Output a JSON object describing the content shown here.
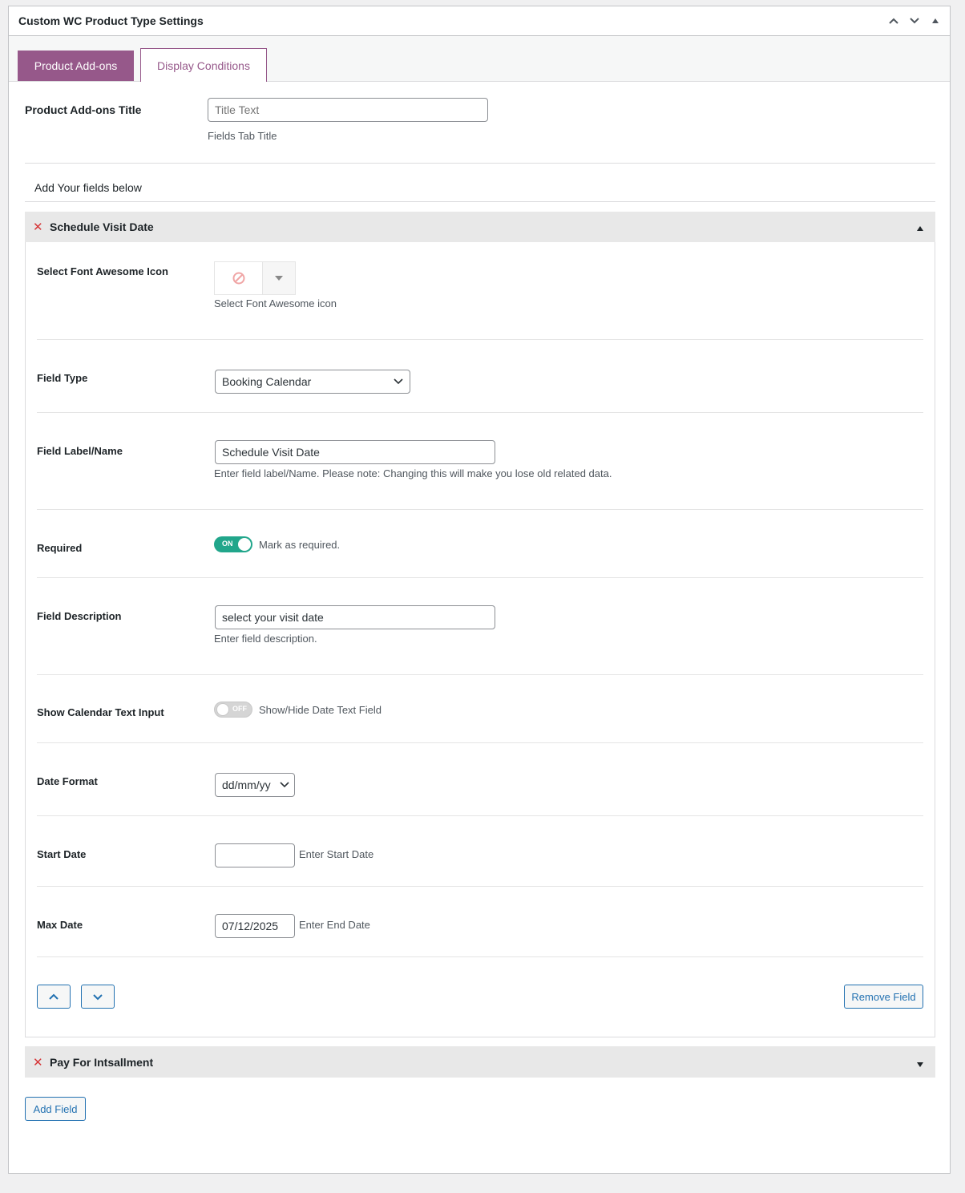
{
  "metabox": {
    "title": "Custom WC Product Type Settings"
  },
  "tabs": [
    {
      "label": "Product Add-ons",
      "active": true
    },
    {
      "label": "Display Conditions",
      "active": false
    }
  ],
  "addons_title": {
    "label": "Product Add-ons Title",
    "placeholder": "Title Text",
    "description": "Fields Tab Title"
  },
  "fields_intro": "Add Your fields below",
  "fields": [
    {
      "title": "Schedule Visit Date",
      "expanded": true,
      "icon": {
        "label": "Select Font Awesome Icon",
        "description": "Select Font Awesome icon",
        "selected_icon": "ban-icon"
      },
      "field_type": {
        "label": "Field Type",
        "value": "Booking Calendar"
      },
      "field_label": {
        "label": "Field Label/Name",
        "value": "Schedule Visit Date",
        "description": "Enter field label/Name. Please note: Changing this will make you lose old related data."
      },
      "required": {
        "label": "Required",
        "state_text": "ON",
        "on": true,
        "description": "Mark as required."
      },
      "field_description": {
        "label": "Field Description",
        "value": "select your visit date",
        "description": "Enter field description."
      },
      "show_calendar_input": {
        "label": "Show Calendar Text Input",
        "state_text": "OFF",
        "on": false,
        "description": "Show/Hide Date Text Field"
      },
      "date_format": {
        "label": "Date Format",
        "value": "dd/mm/yy"
      },
      "start_date": {
        "label": "Start Date",
        "value": "",
        "description": "Enter Start Date"
      },
      "max_date": {
        "label": "Max Date",
        "value": "07/12/2025",
        "description": "Enter End Date"
      },
      "remove_label": "Remove Field"
    },
    {
      "title": "Pay For Intsallment",
      "expanded": false
    }
  ],
  "add_field_label": "Add Field",
  "colors": {
    "accent": "#96588a",
    "link": "#2271b1",
    "toggle_on": "#21a68b",
    "remove": "#d63638"
  }
}
